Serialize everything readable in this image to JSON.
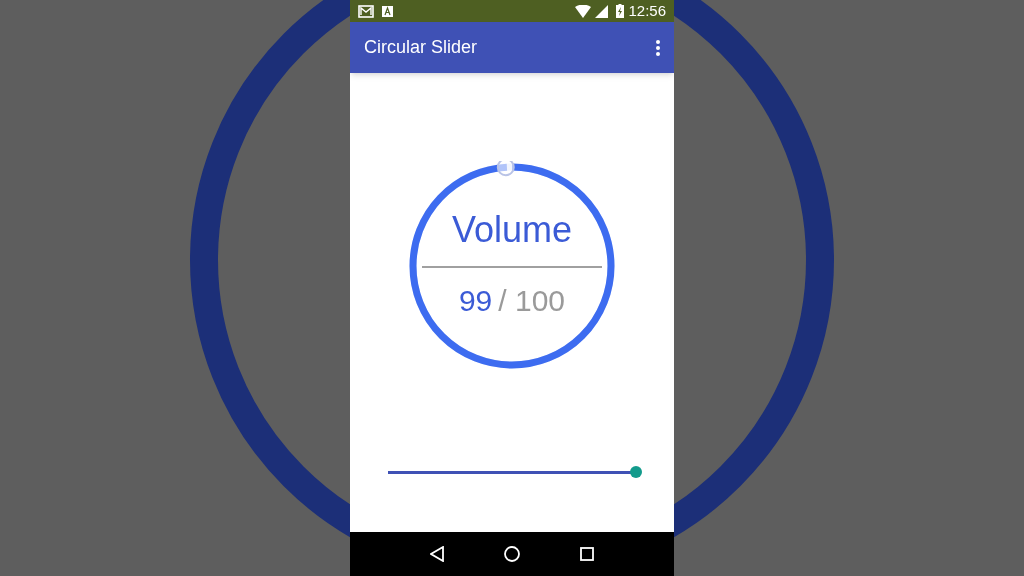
{
  "status_bar": {
    "time": "12:56"
  },
  "app_bar": {
    "title": "Circular Slider"
  },
  "circular_slider": {
    "label": "Volume",
    "value": "99",
    "max": "/ 100",
    "level": 0.99
  },
  "linear_slider": {
    "level": 1.0
  }
}
